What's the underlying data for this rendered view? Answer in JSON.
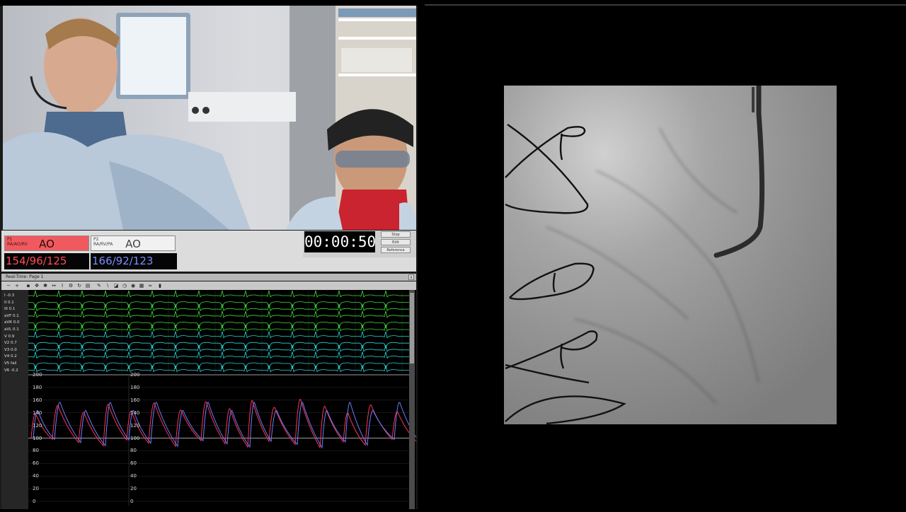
{
  "monitor": {
    "channel1": {
      "label_small": "P1\nRA/AO/RV",
      "name": "AO",
      "reading": "154/96/125",
      "color": "#f05a5f"
    },
    "channel2": {
      "label_small": "P2\nRA/RV/PA",
      "name": "AO",
      "reading": "166/92/123",
      "color": "#7a8cff"
    },
    "timer": "00:00:50",
    "buttons": [
      "Stop",
      "Edit",
      "Reference"
    ]
  },
  "realtime_window": {
    "title": "Real-Time: Page 1",
    "close_label": "x",
    "leads": [
      "I -0.3",
      "II 0.1",
      "III 0.1",
      "aVF 0.1",
      "aVR 0.0",
      "aVL 0.1",
      "V 0.9",
      "V2 0.7",
      "V3 0.0",
      "V4 0.2",
      "V5 fail",
      "V6 -0.2"
    ],
    "lead_colors": {
      "limb": "#3ddc3d",
      "precordial": "#29d6d6",
      "p1": "#ff3355",
      "p2": "#6d7dff"
    },
    "ecg_scale_top": "200",
    "pressure_scale": [
      "180",
      "160",
      "140",
      "120",
      "100",
      "80",
      "60",
      "40",
      "20",
      "0"
    ],
    "pressure_scale_inner": [
      "200",
      "180",
      "160",
      "140",
      "120",
      "100",
      "80",
      "60",
      "40",
      "20",
      "0"
    ]
  }
}
